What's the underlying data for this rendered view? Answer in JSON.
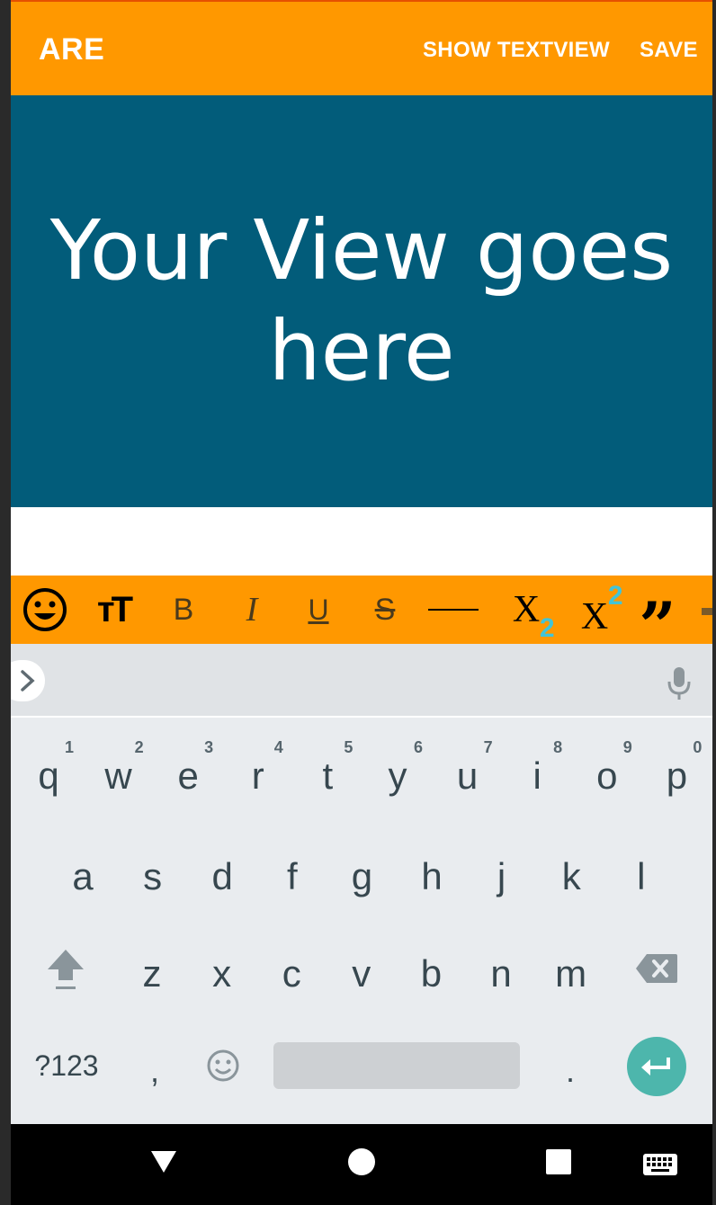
{
  "app_bar": {
    "title": "ARE",
    "actions": [
      "SHOW TEXTVIEW",
      "SAVE"
    ]
  },
  "content": {
    "placeholder_text": "Your View goes here"
  },
  "toolbar": {
    "items": [
      {
        "name": "emoji",
        "icon": "emoji-icon"
      },
      {
        "name": "font-size",
        "label": "тT"
      },
      {
        "name": "bold",
        "label": "B"
      },
      {
        "name": "italic",
        "label": "I"
      },
      {
        "name": "underline",
        "label": "U"
      },
      {
        "name": "strikethrough",
        "label": "S"
      },
      {
        "name": "horizontal-rule",
        "icon": "horizontal-rule-icon"
      },
      {
        "name": "subscript",
        "label": "X",
        "mark": "2"
      },
      {
        "name": "superscript",
        "label": "X",
        "mark": "2"
      },
      {
        "name": "quote",
        "label": "”"
      }
    ],
    "colors": {
      "background": "#ff9800",
      "accent": "#43c4d6"
    }
  },
  "keyboard": {
    "row1": [
      {
        "key": "q",
        "hint": "1"
      },
      {
        "key": "w",
        "hint": "2"
      },
      {
        "key": "e",
        "hint": "3"
      },
      {
        "key": "r",
        "hint": "4"
      },
      {
        "key": "t",
        "hint": "5"
      },
      {
        "key": "y",
        "hint": "6"
      },
      {
        "key": "u",
        "hint": "7"
      },
      {
        "key": "i",
        "hint": "8"
      },
      {
        "key": "o",
        "hint": "9"
      },
      {
        "key": "p",
        "hint": "0"
      }
    ],
    "row2": [
      "a",
      "s",
      "d",
      "f",
      "g",
      "h",
      "j",
      "k",
      "l"
    ],
    "row3": [
      "z",
      "x",
      "c",
      "v",
      "b",
      "n",
      "m"
    ],
    "symbols_key": "?123",
    "comma": ",",
    "period": ".",
    "icons": [
      "shift-icon",
      "backspace-icon",
      "emoji-icon",
      "enter-icon",
      "mic-icon",
      "expand-icon"
    ],
    "colors": {
      "background": "#e9ecef",
      "enter": "#4db6ac"
    }
  },
  "colors": {
    "app_bar": "#ff9800",
    "content": "#025c7a"
  }
}
